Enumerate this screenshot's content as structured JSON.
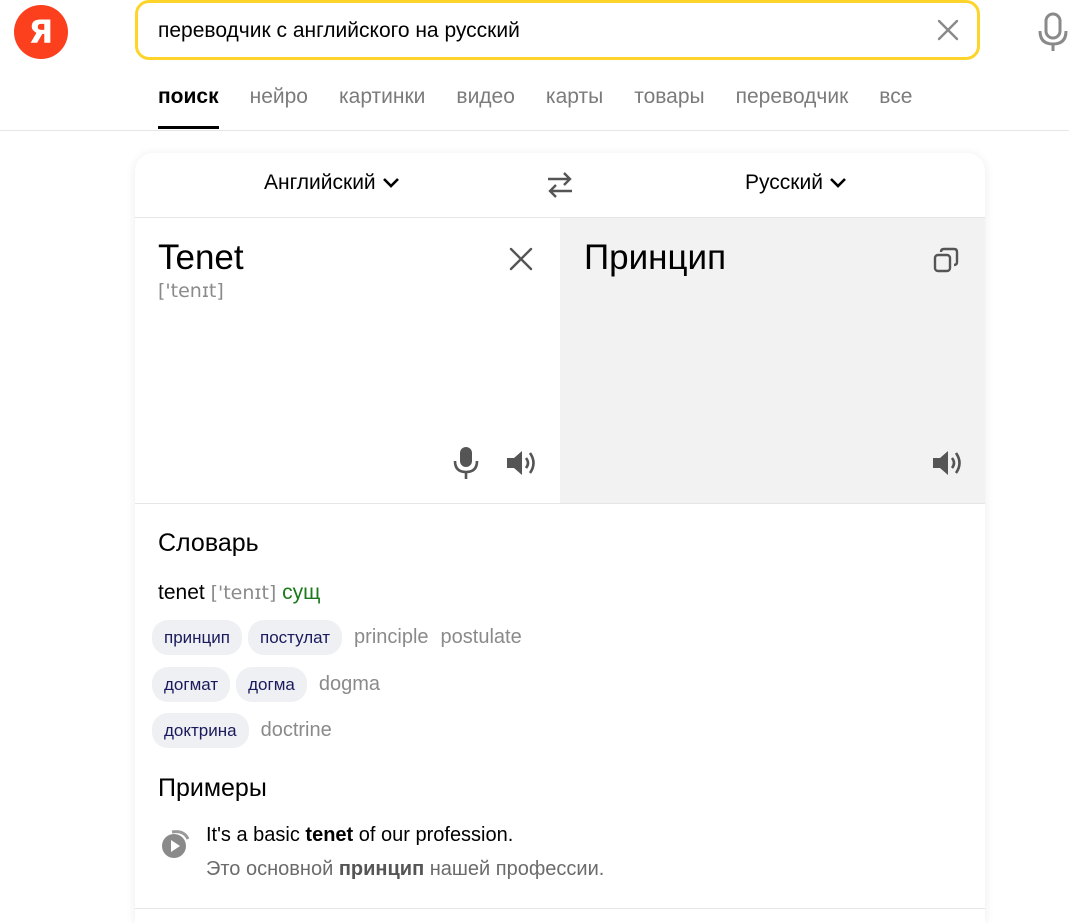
{
  "logo": {
    "letter": "Я"
  },
  "search": {
    "query": "переводчик с английского на русский"
  },
  "tabs": [
    {
      "label": "поиск",
      "active": true
    },
    {
      "label": "нейро",
      "active": false
    },
    {
      "label": "картинки",
      "active": false
    },
    {
      "label": "видео",
      "active": false
    },
    {
      "label": "карты",
      "active": false
    },
    {
      "label": "товары",
      "active": false
    },
    {
      "label": "переводчик",
      "active": false
    },
    {
      "label": "все",
      "active": false
    }
  ],
  "translator": {
    "source_lang": "Английский",
    "target_lang": "Русский",
    "source_text": "Tenet",
    "source_transcription": "['tenɪt]",
    "translation": "Принцип"
  },
  "dictionary": {
    "title": "Словарь",
    "word": "tenet",
    "transcription": "['tenɪt]",
    "pos": "сущ",
    "rows": [
      {
        "chips": [
          "принцип",
          "постулат"
        ],
        "english": [
          "principle",
          "postulate"
        ]
      },
      {
        "chips": [
          "догмат",
          "догма"
        ],
        "english": [
          "dogma"
        ]
      },
      {
        "chips": [
          "доктрина"
        ],
        "english": [
          "doctrine"
        ]
      }
    ]
  },
  "examples": {
    "title": "Примеры",
    "en_before": "It's a basic ",
    "en_bold": "tenet",
    "en_after": " of our profession.",
    "ru_before": "Это основной ",
    "ru_bold": "принцип",
    "ru_after": " нашей профессии."
  },
  "colors": {
    "logo": "#fc3f1d",
    "search_border": "#fed42b",
    "pos_green": "#1c7a1c",
    "chip_bg": "#eef0f3",
    "target_pane_bg": "#f2f2f2"
  },
  "icons": [
    "clear-icon",
    "microphone-icon",
    "swap-icon",
    "chevron-down-icon",
    "speaker-icon",
    "copy-icon",
    "play-icon"
  ]
}
